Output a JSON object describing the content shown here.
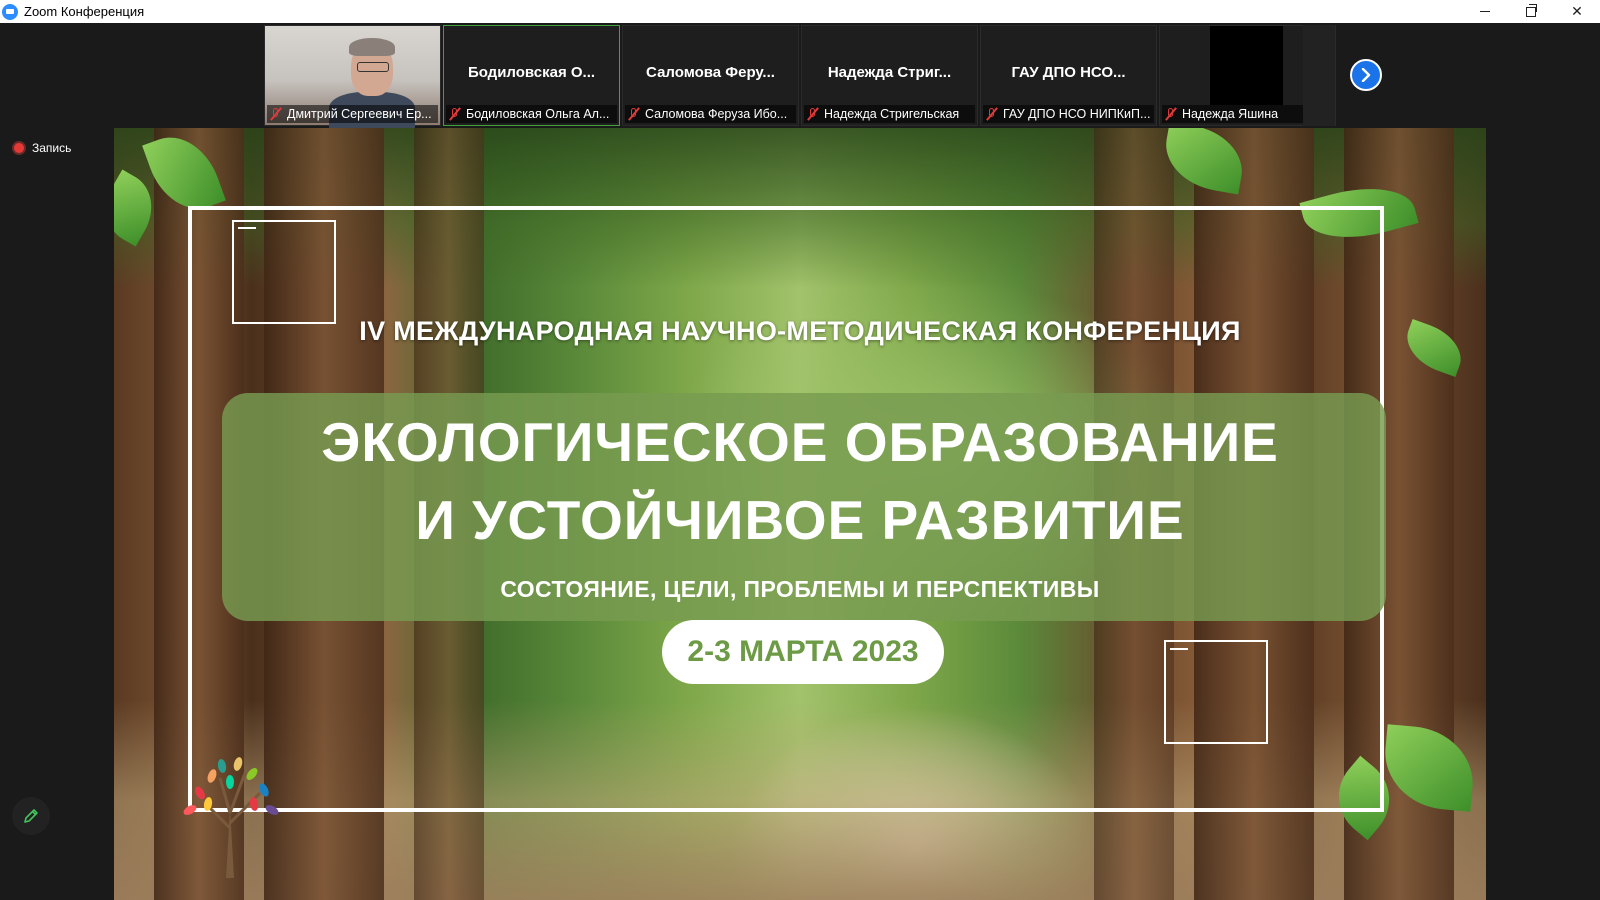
{
  "window": {
    "title": "Zoom Конференция"
  },
  "participants": [
    {
      "display_name": "",
      "label": "Дмитрий Сергеевич Ер...",
      "has_video": true
    },
    {
      "display_name": "Бодиловская  О...",
      "label": "Бодиловская Ольга Ал...",
      "active": true
    },
    {
      "display_name": "Саломова  Феру...",
      "label": "Саломова Феруза Ибо..."
    },
    {
      "display_name": "Надежда  Стриг...",
      "label": "Надежда Стригельская"
    },
    {
      "display_name": "ГАУ  ДПО  НСО...",
      "label": "ГАУ ДПО НСО НИПКиП..."
    },
    {
      "display_name": "",
      "label": "Надежда Яшина",
      "black_video": true
    }
  ],
  "recording": {
    "label": "Запись"
  },
  "slide": {
    "conference_line": "IV МЕЖДУНАРОДНАЯ НАУЧНО-МЕТОДИЧЕСКАЯ КОНФЕРЕНЦИЯ",
    "title_line1": "ЭКОЛОГИЧЕСКОЕ ОБРАЗОВАНИЕ",
    "title_line2": "И УСТОЙЧИВОЕ РАЗВИТИЕ",
    "subtitle": "СОСТОЯНИЕ, ЦЕЛИ, ПРОБЛЕМЫ И ПЕРСПЕКТИВЫ",
    "date": "2-3 МАРТА 2023"
  },
  "icons": {
    "app": "zoom-logo-icon",
    "mic": "mic-muted-icon",
    "next": "chevron-right-icon",
    "annotate": "pencil-icon"
  },
  "colors": {
    "accent_blue": "#1a73e8",
    "active_speaker": "#3fa33a",
    "muted_red": "#e03b3b",
    "slide_green": "#6d9a45"
  }
}
